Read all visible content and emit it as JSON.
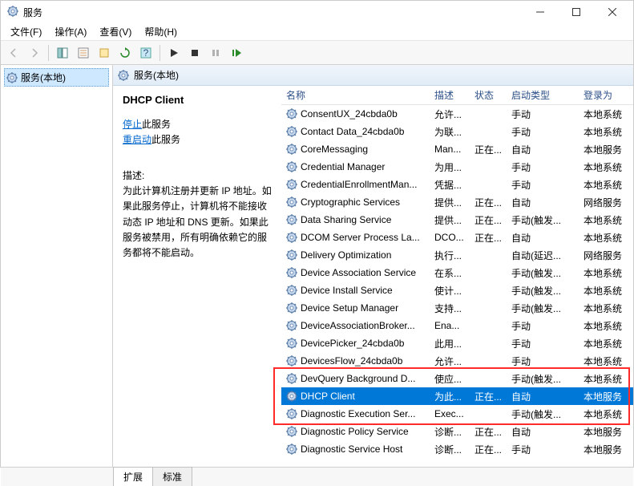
{
  "window": {
    "title": "服务"
  },
  "menu": {
    "file": "文件(F)",
    "action": "操作(A)",
    "view": "查看(V)",
    "help": "帮助(H)"
  },
  "left": {
    "node": "服务(本地)"
  },
  "righthdr": {
    "label": "服务(本地)"
  },
  "detail": {
    "title": "DHCP Client",
    "stop_link": "停止",
    "stop_suffix": "此服务",
    "restart_link": "重启动",
    "restart_suffix": "此服务",
    "desc_label": "描述:",
    "desc_text": "为此计算机注册并更新 IP 地址。如果此服务停止，计算机将不能接收动态 IP 地址和 DNS 更新。如果此服务被禁用，所有明确依赖它的服务都将不能启动。"
  },
  "columns": {
    "name": "名称",
    "desc": "描述",
    "status": "状态",
    "startup": "启动类型",
    "logon": "登录为"
  },
  "services": [
    {
      "name": "ConsentUX_24cbda0b",
      "desc": "允许...",
      "status": "",
      "startup": "手动",
      "logon": "本地系统"
    },
    {
      "name": "Contact Data_24cbda0b",
      "desc": "为联...",
      "status": "",
      "startup": "手动",
      "logon": "本地系统"
    },
    {
      "name": "CoreMessaging",
      "desc": "Man...",
      "status": "正在...",
      "startup": "自动",
      "logon": "本地服务"
    },
    {
      "name": "Credential Manager",
      "desc": "为用...",
      "status": "",
      "startup": "手动",
      "logon": "本地系统"
    },
    {
      "name": "CredentialEnrollmentMan...",
      "desc": "凭据...",
      "status": "",
      "startup": "手动",
      "logon": "本地系统"
    },
    {
      "name": "Cryptographic Services",
      "desc": "提供...",
      "status": "正在...",
      "startup": "自动",
      "logon": "网络服务"
    },
    {
      "name": "Data Sharing Service",
      "desc": "提供...",
      "status": "正在...",
      "startup": "手动(触发...",
      "logon": "本地系统"
    },
    {
      "name": "DCOM Server Process La...",
      "desc": "DCO...",
      "status": "正在...",
      "startup": "自动",
      "logon": "本地系统"
    },
    {
      "name": "Delivery Optimization",
      "desc": "执行...",
      "status": "",
      "startup": "自动(延迟...",
      "logon": "网络服务"
    },
    {
      "name": "Device Association Service",
      "desc": "在系...",
      "status": "",
      "startup": "手动(触发...",
      "logon": "本地系统"
    },
    {
      "name": "Device Install Service",
      "desc": "使计...",
      "status": "",
      "startup": "手动(触发...",
      "logon": "本地系统"
    },
    {
      "name": "Device Setup Manager",
      "desc": "支持...",
      "status": "",
      "startup": "手动(触发...",
      "logon": "本地系统"
    },
    {
      "name": "DeviceAssociationBroker...",
      "desc": "Ena...",
      "status": "",
      "startup": "手动",
      "logon": "本地系统"
    },
    {
      "name": "DevicePicker_24cbda0b",
      "desc": "此用...",
      "status": "",
      "startup": "手动",
      "logon": "本地系统"
    },
    {
      "name": "DevicesFlow_24cbda0b",
      "desc": "允许...",
      "status": "",
      "startup": "手动",
      "logon": "本地系统"
    },
    {
      "name": "DevQuery Background D...",
      "desc": "使应...",
      "status": "",
      "startup": "手动(触发...",
      "logon": "本地系统"
    },
    {
      "name": "DHCP Client",
      "desc": "为此...",
      "status": "正在...",
      "startup": "自动",
      "logon": "本地服务",
      "selected": true
    },
    {
      "name": "Diagnostic Execution Ser...",
      "desc": "Exec...",
      "status": "",
      "startup": "手动(触发...",
      "logon": "本地系统"
    },
    {
      "name": "Diagnostic Policy Service",
      "desc": "诊断...",
      "status": "正在...",
      "startup": "自动",
      "logon": "本地服务"
    },
    {
      "name": "Diagnostic Service Host",
      "desc": "诊断...",
      "status": "正在...",
      "startup": "手动",
      "logon": "本地服务"
    }
  ],
  "tabs": {
    "extended": "扩展",
    "standard": "标准"
  }
}
